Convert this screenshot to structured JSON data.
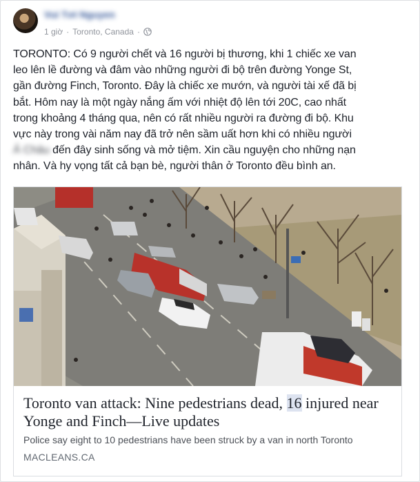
{
  "post": {
    "author": "Vui Tơi Nguyen",
    "time": "1 giờ",
    "location": "Toronto, Canada",
    "privacy_icon": "globe-icon",
    "text_lines": [
      "TORONTO: Có 9 người chết và 16 người bị thương, khi 1 chiếc xe van",
      "leo lên lề đường và đâm vào những người đi bộ trên đường Yonge St,",
      "gần đường Finch, Toronto. Đây là chiếc xe mướn, và người tài xế đã bị",
      "bắt. Hôm nay là một ngày nắng ấm với nhiệt độ lên tới 20C, cao nhất",
      "trong khoảng 4 tháng qua, nên có rất nhiều người ra đường đi bộ. Khu",
      "vực này trong vài năm nay đã trở nên sầm uất hơn khi có nhiều người"
    ],
    "line7_blurred": "Á́ Châu",
    "line7_rest": " đến đây sinh sống và mở tiệm. Xin cầu nguyện cho những nạn",
    "text_last_line": "nhân. Và hy vọng tất cả bạn bè, người thân ở Toronto đều bình an."
  },
  "link": {
    "title_part1": "Toronto van attack: Nine pedestrians dead, ",
    "title_highlight": "16",
    "title_part2": " injured near Yonge and Finch—Live updates",
    "description": "Police say eight to 10 pedestrians have been struck by a van in north Toronto",
    "domain": "MACLEANS.CA"
  }
}
